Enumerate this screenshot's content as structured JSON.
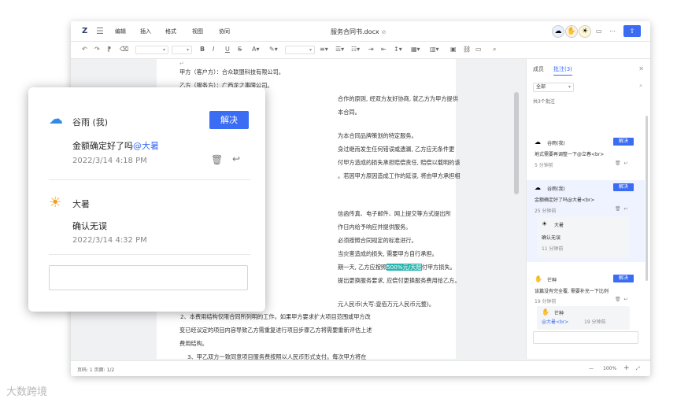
{
  "menubar": {
    "logo": "Z",
    "menu": [
      "编辑",
      "插入",
      "格式",
      "视图",
      "协同"
    ],
    "title": "服务合同书.docx",
    "sync_icon": "check-circle-icon",
    "avatars": [
      "raincloud-avatar",
      "hand-avatar",
      "sun-avatar"
    ],
    "share_icon": "share-icon"
  },
  "toolbar": {
    "font_placeholder": "",
    "size_placeholder": "",
    "bold": "B",
    "italic": "I",
    "underline": "U",
    "strike": "S"
  },
  "document": {
    "lines": [
      "甲方（客户方）：合众联盟科技有限公司。",
      "乙方（服务方）：广西龙之事限公司。",
      "合作的原则, 经双方友好协商, 就乙方为甲方提供",
      "本合同。",
      "为本合同品牌策划的特定服务。",
      "身过继而发生任何错误或遗漏, 乙方应无条件更",
      "付甲方造成的损失承担赔偿责任, 赔偿以载明的该",
      "。若因甲方原因造成工作的延误, 将由甲方承担相",
      "信函传真、电子邮件、网上提交等方式提出所",
      "作日内给予响应并提供服务。",
      "必须按照合同规定的标准进行。",
      "当灾害造成的损失, 需要甲方自行承担。",
      "期一天, 乙方应按照500%元/天赔付甲方损失。",
      "提出更换服务要求, 应偿付更换服务费用给乙方。",
      "元人民币(大写:壹佰万元人民币元整)。",
      "2、本费用结构仅限合同所列明的工作。如果甲方要求扩大项目范围或甲方改",
      "变已经议定的项目内容导致乙方需重复进行项目步骤乙方将需要重新评估上述",
      "费用结构。",
      "3、甲乙双方一致同意项目服务费按照以人民币形式支付。每次甲方将在"
    ],
    "highlight": "500%元/天赔"
  },
  "panel": {
    "tabs": [
      "成员",
      "批注(3)"
    ],
    "filter": "全部",
    "count": "共3个批注",
    "comments": [
      {
        "name": "谷雨(我)",
        "text": "地式需要再调整一下@立春<br>",
        "time": "5 分钟前",
        "resolve": "解决"
      },
      {
        "name": "谷雨(我)",
        "text": "金额确定好了吗@大暑<br>",
        "time": "25 分钟前",
        "resolve": "解决",
        "reply": {
          "name": "大暑",
          "text": "确认无误",
          "time": "11 分钟前"
        }
      },
      {
        "name": "芒种",
        "text": "该篇没有完全覆, 需要补充一下比例",
        "time": "19 分钟前",
        "resolve": "解决",
        "reply": {
          "name": "芒种",
          "text": "@大暑<br>",
          "time": "19 分钟前"
        }
      }
    ]
  },
  "statusbar": {
    "left": "页码: 1  页面: 1/2",
    "zoom": "100%",
    "minus": "—",
    "plus": "+"
  },
  "popup": {
    "user1": "谷雨 (我)",
    "resolve": "解决",
    "text1": "金额确定好了吗",
    "mention1": "@大暑",
    "time1": "2022/3/14 4:18 PM",
    "user2": "大暑",
    "text2": "确认无误",
    "time2": "2022/3/14 4:32 PM"
  },
  "watermark": "大数跨境"
}
